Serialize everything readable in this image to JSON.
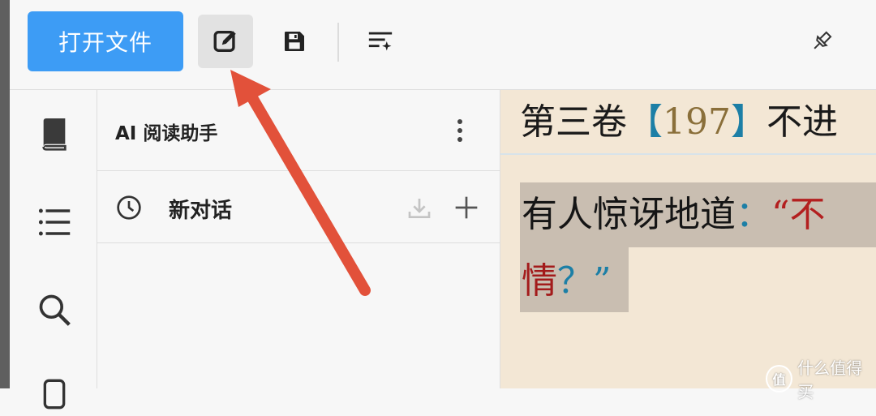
{
  "toolbar": {
    "open_file_label": "打开文件",
    "icons": [
      "edit-icon",
      "save-icon",
      "ai-sparkle-list-icon",
      "pin-icon"
    ]
  },
  "sidebar": {
    "icons": [
      "book-icon",
      "list-icon",
      "search-icon",
      "bookmark-icon"
    ]
  },
  "assistant": {
    "title": "AI 阅读助手",
    "conversation_label": "新对话"
  },
  "reader": {
    "chapter_prefix": "第三卷",
    "bracket_open": "【",
    "chapter_number": "197",
    "bracket_close": "】",
    "chapter_suffix": "不进",
    "line1_text": "有人惊讶地道",
    "line1_colon": "：",
    "line1_quote": "“不",
    "line2_text": "情",
    "line2_punct": "？”",
    "background_color": "#f3e7d5",
    "highlight_color": "#c9beb1"
  },
  "annotation": {
    "arrow_color": "#e2513a"
  },
  "watermark": {
    "badge": "值",
    "text": "什么值得买"
  },
  "colors": {
    "accent": "#3d9cf5",
    "panel_bg": "#f7f7f7"
  }
}
